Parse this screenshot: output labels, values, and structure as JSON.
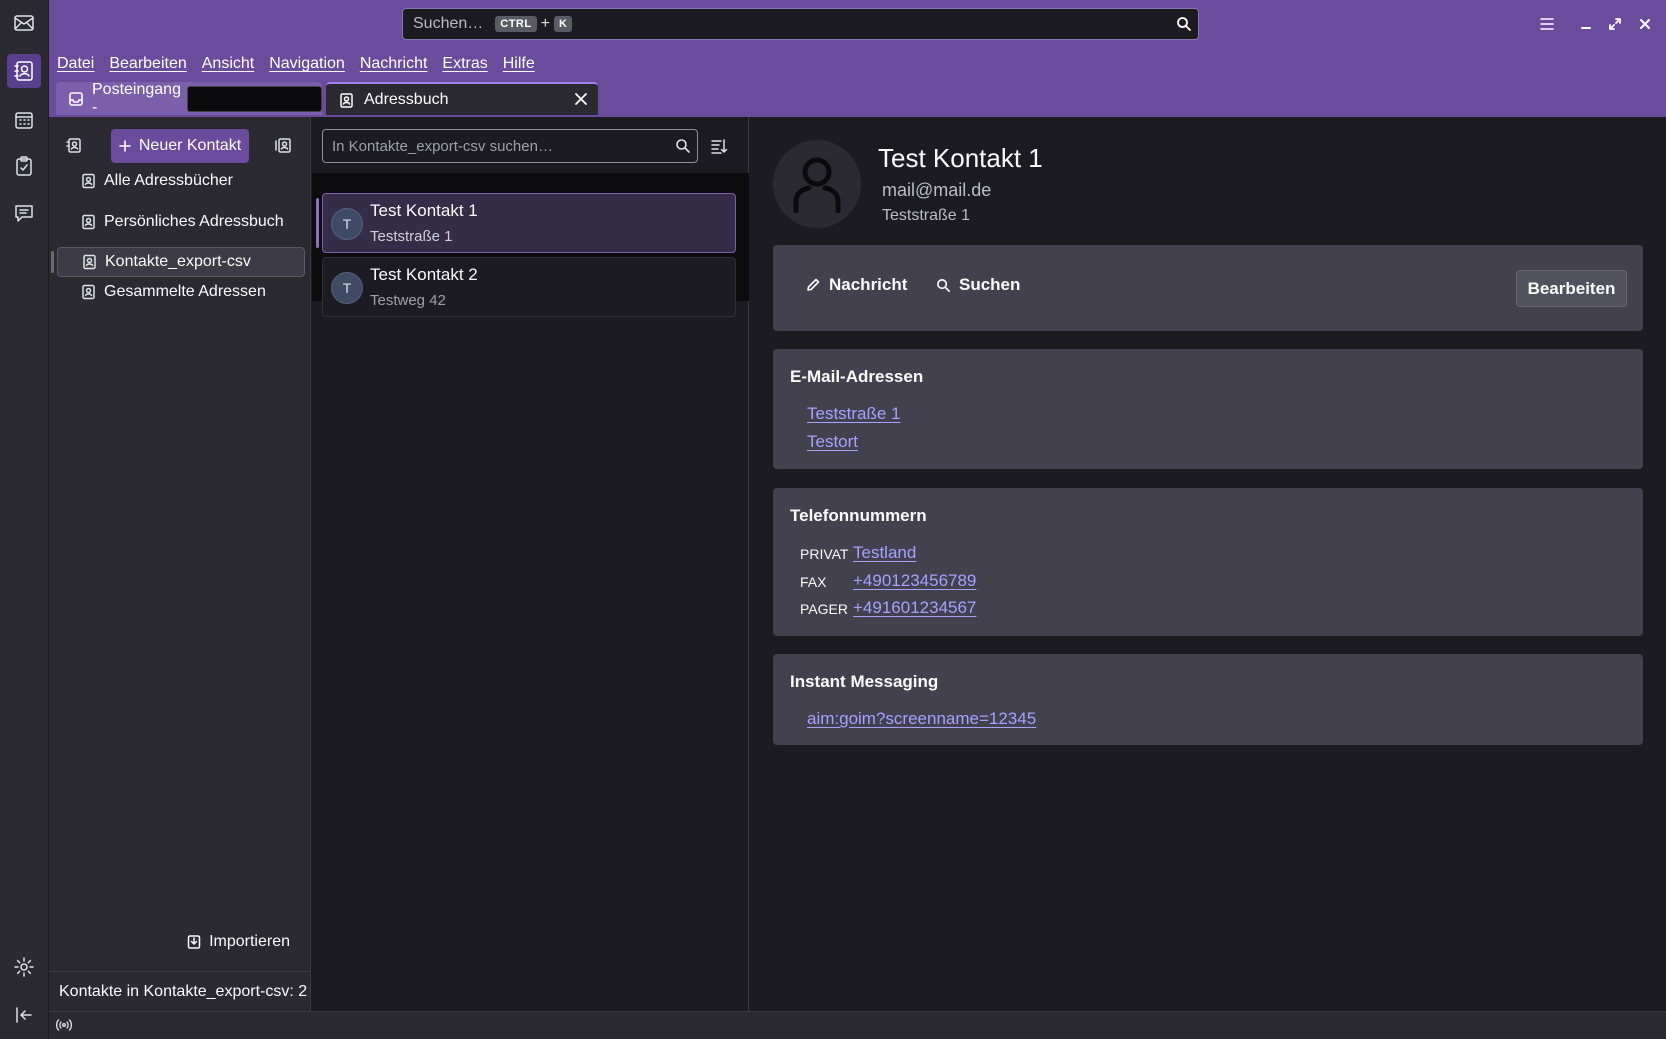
{
  "window": {
    "search_placeholder": "Suchen…",
    "search_shortcut_mod": "CTRL",
    "search_shortcut_plus": "+",
    "search_shortcut_key": "K"
  },
  "menubar": {
    "items": [
      "Datei",
      "Bearbeiten",
      "Ansicht",
      "Navigation",
      "Nachricht",
      "Extras",
      "Hilfe"
    ]
  },
  "tabs": [
    {
      "label": "Posteingang -"
    },
    {
      "label": "Adressbuch"
    }
  ],
  "sidebar": {
    "new_contact_label": "Neuer Kontakt",
    "books": [
      {
        "label": "Alle Adressbücher"
      },
      {
        "label": "Persönliches Adressbuch"
      },
      {
        "label": "Kontakte_export-csv"
      },
      {
        "label": "Gesammelte Adressen"
      }
    ],
    "import_label": "Importieren",
    "count_text": "Kontakte in Kontakte_export-csv: 2"
  },
  "contact_list": {
    "search_placeholder": "In Kontakte_export-csv suchen…",
    "items": [
      {
        "initial": "T",
        "name": "Test Kontakt 1",
        "sub": "Teststraße 1"
      },
      {
        "initial": "T",
        "name": "Test Kontakt 2",
        "sub": "Testweg 42"
      }
    ]
  },
  "details": {
    "name": "Test Kontakt 1",
    "email": "mail@mail.de",
    "address": "Teststraße 1",
    "actions": {
      "message_label": "Nachricht",
      "search_label": "Suchen",
      "edit_label": "Bearbeiten"
    },
    "email_section": {
      "title": "E-Mail-Adressen",
      "links": [
        "Teststraße 1",
        "Testort"
      ]
    },
    "phone_section": {
      "title": "Telefonnummern",
      "rows": [
        {
          "label": "PRIVAT",
          "value": "Testland"
        },
        {
          "label": "FAX",
          "value": "+490123456789"
        },
        {
          "label": "PAGER",
          "value": "+491601234567"
        }
      ]
    },
    "im_section": {
      "title": "Instant Messaging",
      "value": "aim:goim?screenname=12345"
    }
  },
  "colors": {
    "accent": "#6a4b9c",
    "link": "#a8a0ff",
    "panel": "#42414d"
  }
}
